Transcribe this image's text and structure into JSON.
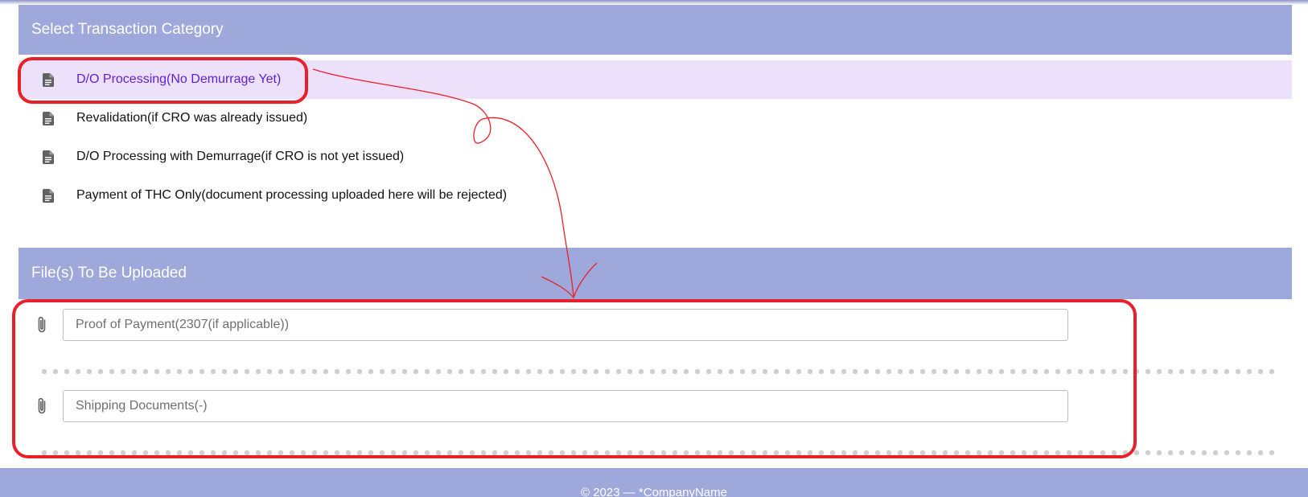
{
  "sections": {
    "transaction_category_title": "Select Transaction Category",
    "files_title": "File(s) To Be Uploaded"
  },
  "categories": [
    {
      "label": "D/O Processing(No Demurrage Yet)",
      "selected": true,
      "icon": "document-icon"
    },
    {
      "label": "Revalidation(if CRO was already issued)",
      "selected": false,
      "icon": "document-icon"
    },
    {
      "label": "D/O Processing with Demurrage(if CRO is not yet issued)",
      "selected": false,
      "icon": "document-icon"
    },
    {
      "label": "Payment of THC Only(document processing uploaded here will be rejected)",
      "selected": false,
      "icon": "document-icon"
    }
  ],
  "uploads": [
    {
      "placeholder": "Proof of Payment(2307(if applicable))",
      "icon": "paperclip-icon"
    },
    {
      "placeholder": "Shipping Documents(-)",
      "icon": "paperclip-icon"
    }
  ],
  "footer": {
    "text": "© 2023 — *CompanyName"
  },
  "colors": {
    "header_bg": "#9fa8da",
    "selected_bg": "#ede0fb",
    "selected_text": "#5d1ed6",
    "annotation_red": "#e8202a"
  }
}
